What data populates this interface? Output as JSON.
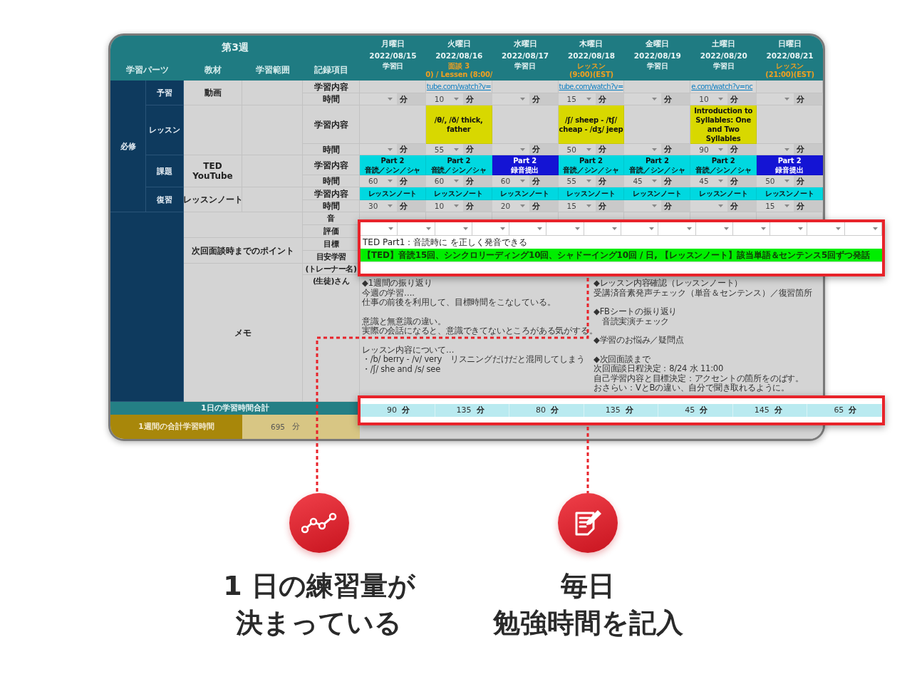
{
  "sheet": {
    "week_title": "第3週",
    "column_headers": [
      "学習パーツ",
      "教材",
      "学習範囲",
      "記録項目"
    ],
    "days": [
      {
        "day": "月曜日",
        "date": "2022/08/15",
        "status": [
          "学習日"
        ],
        "kind": "study"
      },
      {
        "day": "火曜日",
        "date": "2022/08/16",
        "status": [
          "面談 3",
          "0) / Lessen (8:00/"
        ],
        "kind": "lesson"
      },
      {
        "day": "水曜日",
        "date": "2022/08/17",
        "status": [
          "学習日"
        ],
        "kind": "study"
      },
      {
        "day": "木曜日",
        "date": "2022/08/18",
        "status": [
          "レッスン",
          "(9:00)(EST)"
        ],
        "kind": "lesson"
      },
      {
        "day": "金曜日",
        "date": "2022/08/19",
        "status": [
          "学習日"
        ],
        "kind": "study"
      },
      {
        "day": "土曜日",
        "date": "2022/08/20",
        "status": [
          "学習日"
        ],
        "kind": "study"
      },
      {
        "day": "日曜日",
        "date": "2022/08/21",
        "status": [
          "レッスン",
          "(21:00)(EST)"
        ],
        "kind": "lesson"
      }
    ],
    "category": "必修",
    "sections": [
      {
        "part": "予習",
        "material": [
          "動画"
        ],
        "content_label": "学習内容",
        "time_label": "時間",
        "content": [
          {
            "kind": "empty"
          },
          {
            "kind": "link",
            "text": "tube.com/watch?v="
          },
          {
            "kind": "empty"
          },
          {
            "kind": "link",
            "text": "tube.com/watch?v="
          },
          {
            "kind": "empty"
          },
          {
            "kind": "link",
            "text": "e.com/watch?v=nc"
          },
          {
            "kind": "empty"
          }
        ],
        "times": [
          {
            "unit": "分"
          },
          {
            "value": "10",
            "unit": "分"
          },
          {
            "unit": "分"
          },
          {
            "value": "15",
            "unit": "分"
          },
          {
            "unit": "分"
          },
          {
            "value": "10",
            "unit": "分"
          },
          {
            "unit": "分"
          }
        ]
      },
      {
        "part": "レッスン",
        "content_label": "学習内容",
        "time_label": "時間",
        "content": [
          {
            "kind": "empty"
          },
          {
            "kind": "note",
            "lines": [
              "/θ/, /ð/ thick,",
              "father"
            ],
            "color": "#d8d800"
          },
          {
            "kind": "empty"
          },
          {
            "kind": "note",
            "lines": [
              "/ʃ/ sheep - /tʃ/",
              "cheap - /dʒ/ jeep"
            ],
            "color": "#d8d800"
          },
          {
            "kind": "empty"
          },
          {
            "kind": "note",
            "lines": [
              "Introduction to",
              "Syllables: One",
              "and Two",
              "Syllables"
            ],
            "color": "#d8d800"
          },
          {
            "kind": "empty"
          }
        ],
        "times": [
          {
            "unit": "分"
          },
          {
            "value": "55",
            "unit": "分"
          },
          {
            "unit": "分"
          },
          {
            "value": "50",
            "unit": "分"
          },
          {
            "unit": "分"
          },
          {
            "value": "90",
            "unit": "分"
          },
          {
            "unit": "分"
          }
        ]
      },
      {
        "part": "課題",
        "material": [
          "TED",
          "YouTube"
        ],
        "content_label": "学習内容",
        "time_label": "時間",
        "content": [
          {
            "kind": "note",
            "lines": [
              "Part 2",
              "音読／シン／シャ"
            ],
            "color": "#00d8e0"
          },
          {
            "kind": "note",
            "lines": [
              "Part 2",
              "音読／シン／シャ"
            ],
            "color": "#00d8e0"
          },
          {
            "kind": "note",
            "lines": [
              "Part 2",
              "録音提出"
            ],
            "color": "#1414d4"
          },
          {
            "kind": "note",
            "lines": [
              "Part 2",
              "音読／シン／シャ"
            ],
            "color": "#00d8e0"
          },
          {
            "kind": "note",
            "lines": [
              "Part 2",
              "音読／シン／シャ"
            ],
            "color": "#00d8e0"
          },
          {
            "kind": "note",
            "lines": [
              "Part 2",
              "音読／シン／シャ"
            ],
            "color": "#00d8e0"
          },
          {
            "kind": "note",
            "lines": [
              "Part 2",
              "録音提出"
            ],
            "color": "#1414d4"
          }
        ],
        "times": [
          {
            "value": "60",
            "unit": "分"
          },
          {
            "value": "60",
            "unit": "分"
          },
          {
            "value": "60",
            "unit": "分"
          },
          {
            "value": "55",
            "unit": "分"
          },
          {
            "value": "45",
            "unit": "分"
          },
          {
            "value": "45",
            "unit": "分"
          },
          {
            "value": "50",
            "unit": "分"
          }
        ]
      },
      {
        "part": "復習",
        "material": [
          "レッスンノート"
        ],
        "content_label": "学習内容",
        "time_label": "時間",
        "content": [
          {
            "kind": "note",
            "lines": [
              "レッスンノート"
            ],
            "color": "#00d8e0"
          },
          {
            "kind": "note",
            "lines": [
              "レッスンノート"
            ],
            "color": "#00d8e0"
          },
          {
            "kind": "note",
            "lines": [
              "レッスンノート"
            ],
            "color": "#00d8e0"
          },
          {
            "kind": "note",
            "lines": [
              "レッスンノート"
            ],
            "color": "#00d8e0"
          },
          {
            "kind": "note",
            "lines": [
              "レッスンノート"
            ],
            "color": "#00d8e0"
          },
          {
            "kind": "note",
            "lines": [
              "レッスンノート"
            ],
            "color": "#00d8e0"
          },
          {
            "kind": "note",
            "lines": [
              "レッスンノート"
            ],
            "color": "#00d8e0"
          }
        ],
        "times": [
          {
            "value": "30",
            "unit": "分"
          },
          {
            "value": "10",
            "unit": "分"
          },
          {
            "value": "20",
            "unit": "分"
          },
          {
            "value": "15",
            "unit": "分"
          },
          {
            "unit": "分"
          },
          {
            "unit": "分"
          },
          {
            "value": "15",
            "unit": "分"
          }
        ]
      }
    ],
    "lower_labels": [
      "音",
      "評価",
      "目標",
      "目安学習",
      "(トレーナー名)",
      "(生徒)さん"
    ],
    "points_label": "次回面談時までのポイント",
    "memo_label": "メモ",
    "memo_left": [
      [
        "◆1週間の振り返り",
        "今週の学習….",
        "仕事の前後を利用して、目標時間をこなしている。"
      ],
      [
        "意識と無意識の違い。",
        "実際の会話になると、意識できてないところがある気がする。"
      ],
      [
        "レッスン内容について…",
        "・/b/ berry - /v/ very　リスニングだけだと混同してしまう",
        "・/ʃ/ she and /s/ see"
      ]
    ],
    "memo_right": [
      [
        "◆レッスン内容確認（レッスンノート）",
        "受講済音素発声チェック（単音＆センテンス）／復習箇所"
      ],
      [
        "◆FBシートの振り返り",
        "　音読実演チェック"
      ],
      [
        "◆学習のお悩み／疑問点"
      ],
      [
        "◆次回面談まで",
        "次回面談日程決定：8/24 水 11:00",
        "自己学習内容と目標決定：アクセントの箇所をのばす。",
        "おさらい：VとBの違い、自分で聞き取れるように。"
      ]
    ],
    "daily_total": {
      "label": "1日の学習時間合計",
      "values": [
        {
          "value": "90",
          "unit": "分"
        },
        {
          "value": "135",
          "unit": "分"
        },
        {
          "value": "80",
          "unit": "分"
        },
        {
          "value": "135",
          "unit": "分"
        },
        {
          "value": "45",
          "unit": "分"
        },
        {
          "value": "145",
          "unit": "分"
        },
        {
          "value": "65",
          "unit": "分"
        }
      ]
    },
    "weekly_total": {
      "label": "1週間の合計学習時間",
      "value": "695",
      "unit": "分"
    }
  },
  "goal_callout": {
    "goal": "TED Part1：音読時に を正しく発音できる",
    "study_plan": "【TED】音読15回、シンクロリーディング10回、シャドーイング10回 / 日, 【レッスンノート】該当単語＆センテンス5回ずつ発話"
  },
  "features": [
    {
      "kind": "chart",
      "caption": [
        "1 日の練習量が",
        "決まっている"
      ]
    },
    {
      "kind": "note",
      "caption": [
        "毎日",
        "勉強時間を記入"
      ]
    }
  ]
}
